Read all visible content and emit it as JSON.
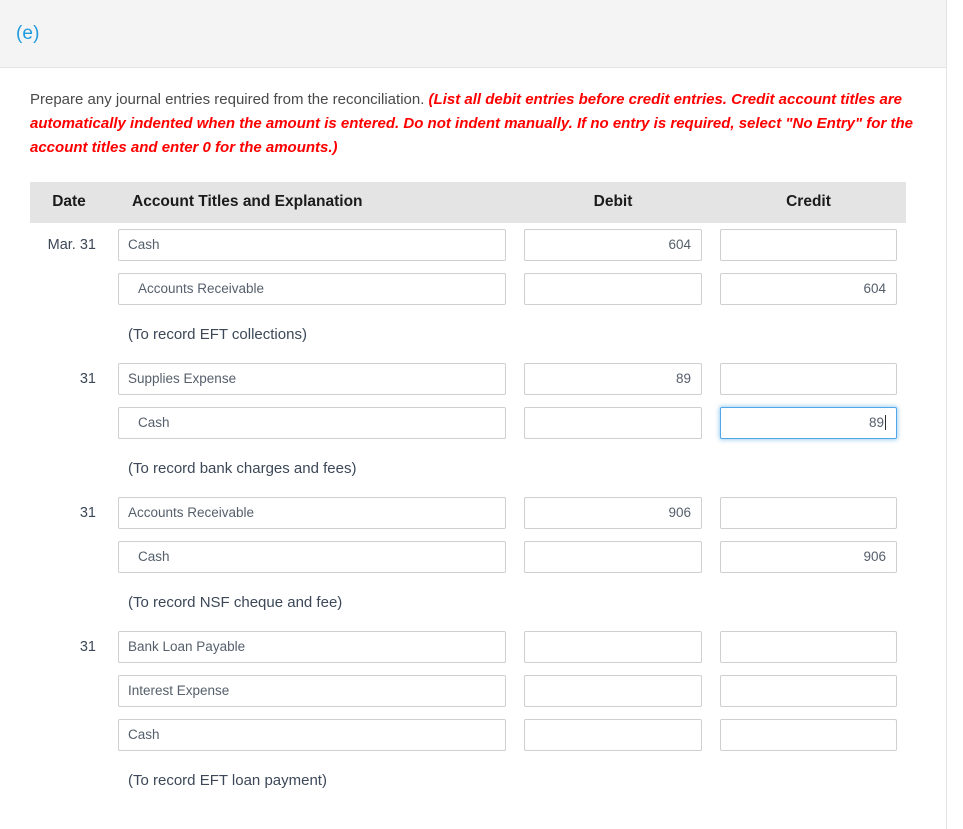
{
  "header": {
    "part_label": "(e)",
    "link_color": "#1f9bde"
  },
  "instructions": {
    "lead": "Prepare any journal entries required from the reconciliation.",
    "requirement": "(List all debit entries before credit entries. Credit account titles are automatically indented when the amount is entered. Do not indent manually. If no entry is required, select \"No Entry\" for the account titles and enter 0 for the amounts.)",
    "requirement_color": "#ff0000"
  },
  "table": {
    "columns": {
      "date": "Date",
      "account": "Account Titles and Explanation",
      "debit": "Debit",
      "credit": "Credit"
    },
    "header_bg": "#e4e4e4",
    "entries": [
      {
        "date": "Mar. 31",
        "memo": "(To record EFT collections)",
        "lines": [
          {
            "date": "Mar. 31",
            "account": "Cash",
            "indented": false,
            "debit": "604",
            "credit": "",
            "focused_field": ""
          },
          {
            "date": "",
            "account": "Accounts Receivable",
            "indented": true,
            "debit": "",
            "credit": "604",
            "focused_field": ""
          }
        ]
      },
      {
        "date": "31",
        "memo": "(To record bank charges and fees)",
        "lines": [
          {
            "date": "31",
            "account": "Supplies Expense",
            "indented": false,
            "debit": "89",
            "credit": "",
            "focused_field": ""
          },
          {
            "date": "",
            "account": "Cash",
            "indented": true,
            "debit": "",
            "credit": "89",
            "focused_field": "credit"
          }
        ]
      },
      {
        "date": "31",
        "memo": "(To record NSF cheque and fee)",
        "lines": [
          {
            "date": "31",
            "account": "Accounts Receivable",
            "indented": false,
            "debit": "906",
            "credit": "",
            "focused_field": ""
          },
          {
            "date": "",
            "account": "Cash",
            "indented": true,
            "debit": "",
            "credit": "906",
            "focused_field": ""
          }
        ]
      },
      {
        "date": "31",
        "memo": "(To record EFT loan payment)",
        "lines": [
          {
            "date": "31",
            "account": "Bank Loan Payable",
            "indented": false,
            "debit": "",
            "credit": "",
            "focused_field": ""
          },
          {
            "date": "",
            "account": "Interest Expense",
            "indented": false,
            "debit": "",
            "credit": "",
            "focused_field": ""
          },
          {
            "date": "",
            "account": "Cash",
            "indented": false,
            "debit": "",
            "credit": "",
            "focused_field": ""
          }
        ]
      }
    ]
  }
}
